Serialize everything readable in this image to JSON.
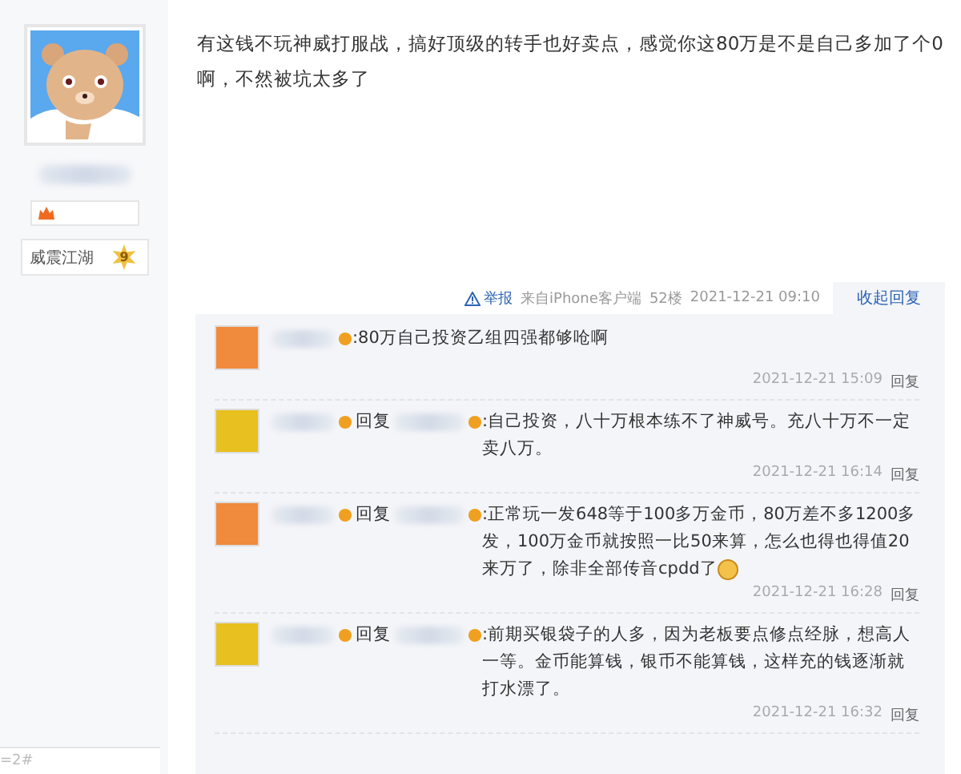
{
  "user": {
    "level_title": "威震江湖",
    "level": "9"
  },
  "post": {
    "text": "有这钱不玩神威打服战，搞好顶级的转手也好卖点，感觉你这80万是不是自己多加了个0啊，不然被坑太多了",
    "meta": {
      "report": "举报",
      "source": "来自iPhone客户端",
      "floor": "52楼",
      "time": "2021-12-21 09:10"
    },
    "collapse": "收起回复"
  },
  "replies": [
    {
      "color": "#f08a3c",
      "text": ":80万自己投资乙组四强都够呛啊",
      "emoji": false,
      "time": "2021-12-21 15:09",
      "action": "回复"
    },
    {
      "color": "#e8c020",
      "reply_label": "回复",
      "text": ":自己投资，八十万根本练不了神威号。充八十万不一定卖八万。",
      "emoji": false,
      "time": "2021-12-21 16:14",
      "action": "回复"
    },
    {
      "color": "#f08a3c",
      "reply_label": "回复",
      "text": ":正常玩一发648等于100多万金币，80万差不多1200多发，100万金币就按照一比50来算，怎么也得也得值20来万了，除非全部传音cpdd了",
      "emoji": true,
      "time": "2021-12-21 16:28",
      "action": "回复"
    },
    {
      "color": "#e8c020",
      "reply_label": "回复",
      "text": ":前期买银袋子的人多，因为老板要点修点经脉，想高人一等。金币能算钱，银币不能算钱，这样充的钱逐渐就打水漂了。",
      "emoji": false,
      "time": "2021-12-21 16:32",
      "action": "回复"
    }
  ],
  "footer": "=2#"
}
